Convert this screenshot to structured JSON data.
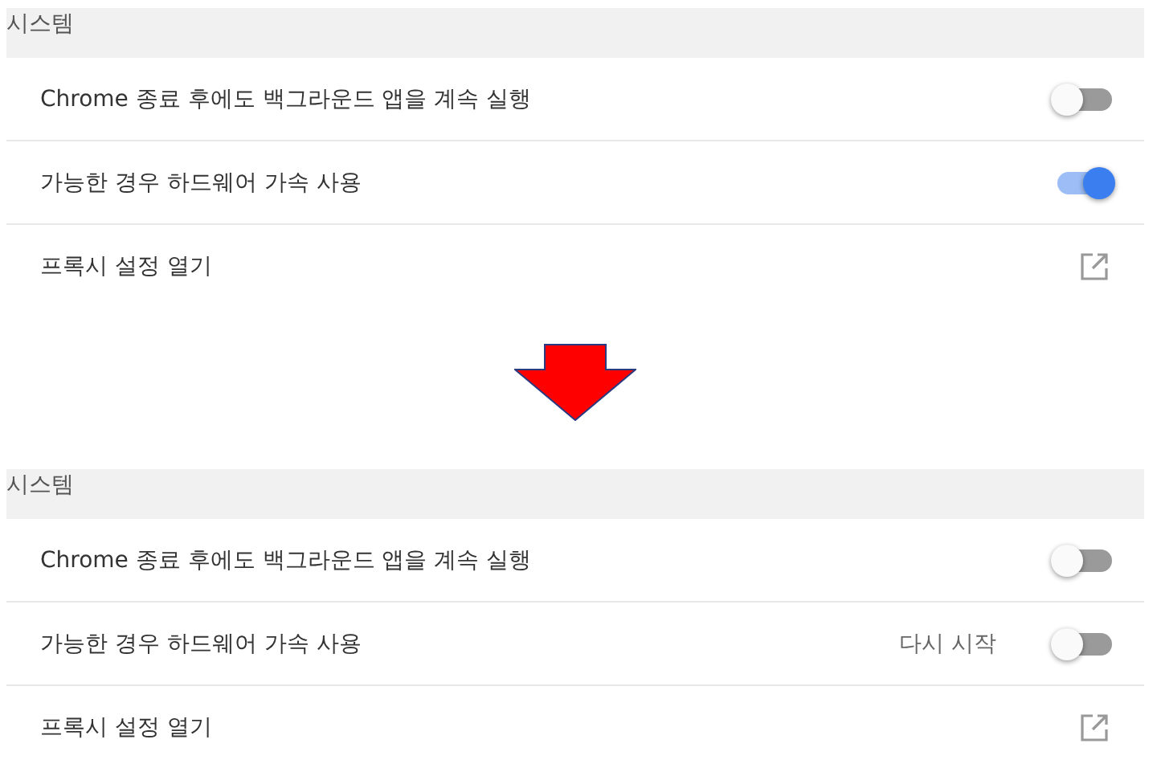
{
  "panels": [
    {
      "title": "시스템",
      "rows": [
        {
          "kind": "toggle",
          "label": "Chrome 종료 후에도 백그라운드 앱을 계속 실행",
          "on": false
        },
        {
          "kind": "toggle",
          "label": "가능한 경우 하드웨어 가속 사용",
          "on": true
        },
        {
          "kind": "link",
          "label": "프록시 설정 열기"
        }
      ]
    },
    {
      "title": "시스템",
      "rows": [
        {
          "kind": "toggle",
          "label": "Chrome 종료 후에도 백그라운드 앱을 계속 실행",
          "on": false
        },
        {
          "kind": "toggle",
          "label": "가능한 경우 하드웨어 가속 사용",
          "on": false,
          "action": "다시 시작"
        },
        {
          "kind": "link",
          "label": "프록시 설정 열기"
        }
      ]
    }
  ]
}
